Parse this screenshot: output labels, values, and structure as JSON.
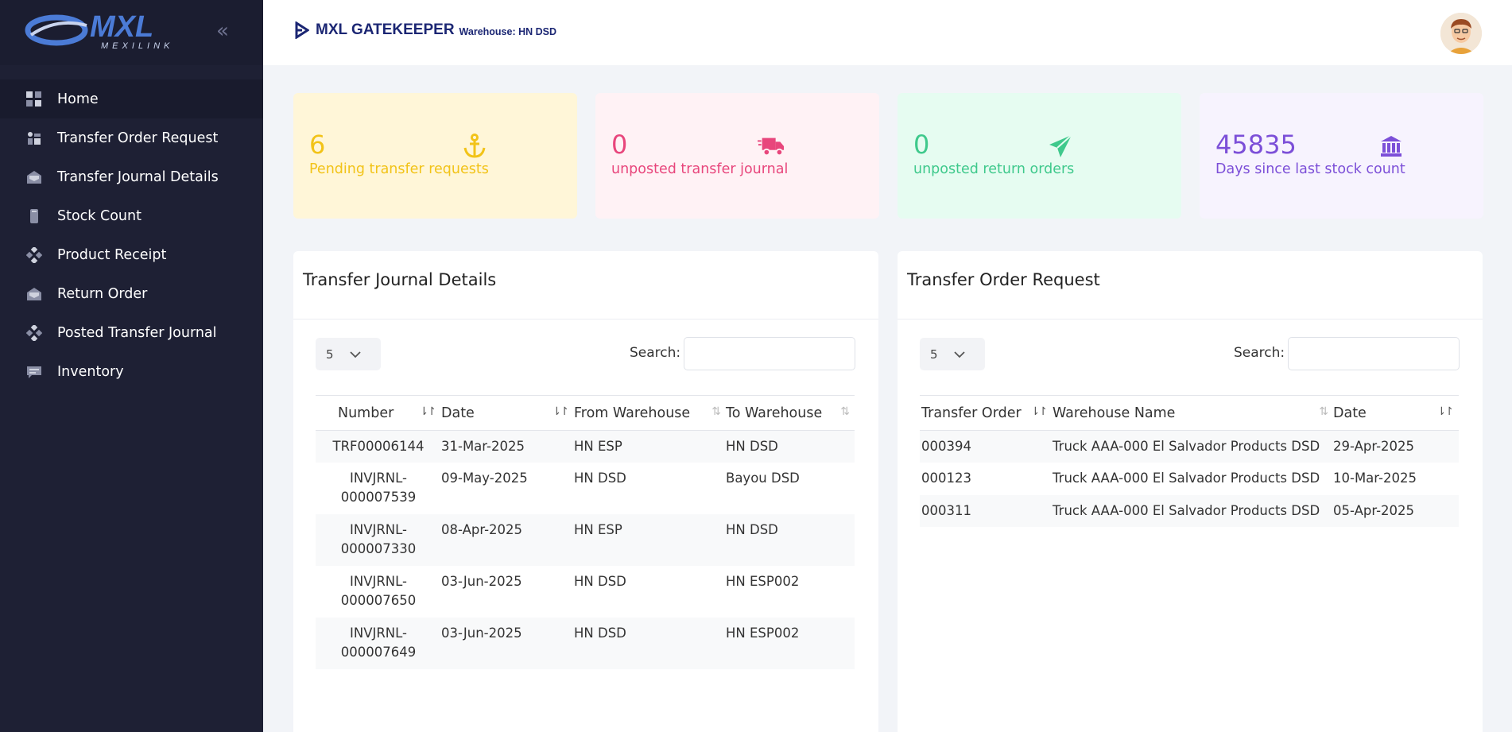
{
  "app": {
    "logo_text": "MXL",
    "logo_sub": "MEXILINK",
    "title": "MXL GATEKEEPER",
    "warehouse": "Warehouse: HN DSD"
  },
  "sidebar": {
    "items": [
      {
        "label": "Home",
        "icon": "home-icon"
      },
      {
        "label": "Transfer Order Request",
        "icon": "transfer-order-icon"
      },
      {
        "label": "Transfer Journal Details",
        "icon": "envelope-icon"
      },
      {
        "label": "Stock Count",
        "icon": "phone-icon"
      },
      {
        "label": "Product Receipt",
        "icon": "diamond-icon"
      },
      {
        "label": "Return Order",
        "icon": "envelope-icon"
      },
      {
        "label": "Posted Transfer Journal",
        "icon": "diamond-icon"
      },
      {
        "label": "Inventory",
        "icon": "message-icon"
      }
    ]
  },
  "cards": [
    {
      "value": "6",
      "label": "Pending transfer requests",
      "color": "#f2c318",
      "bg": "#fff6d8",
      "icon": "anchor-icon"
    },
    {
      "value": "0",
      "label": "unposted transfer journal",
      "color": "#e8467c",
      "bg": "#fff2f5",
      "icon": "truck-icon"
    },
    {
      "value": "0",
      "label": "unposted return orders",
      "color": "#3fc98c",
      "bg": "#e6fcf1",
      "icon": "paper-plane-icon"
    },
    {
      "value": "45835",
      "label": "Days since last stock count",
      "color": "#7c4fd8",
      "bg": "#f7f3fe",
      "icon": "bank-icon"
    }
  ],
  "journal_panel": {
    "title": "Transfer Journal Details",
    "page_length": "5",
    "search_label": "Search:",
    "search_value": "",
    "columns": [
      "Number",
      "Date",
      "From Warehouse",
      "To Warehouse"
    ],
    "rows": [
      [
        "TRF00006144",
        "31-Mar-2025",
        "HN ESP",
        "HN DSD"
      ],
      [
        "INVJRNL-\n000007539",
        "09-May-2025",
        "HN DSD",
        "Bayou DSD"
      ],
      [
        "INVJRNL-\n000007330",
        "08-Apr-2025",
        "HN ESP",
        "HN DSD"
      ],
      [
        "INVJRNL-\n000007650",
        "03-Jun-2025",
        "HN DSD",
        "HN ESP002"
      ],
      [
        "INVJRNL-\n000007649",
        "03-Jun-2025",
        "HN DSD",
        "HN ESP002"
      ]
    ]
  },
  "order_panel": {
    "title": "Transfer Order Request",
    "page_length": "5",
    "search_label": "Search:",
    "search_value": "",
    "columns": [
      "Transfer Order",
      "Warehouse Name",
      "Date"
    ],
    "rows": [
      [
        "000394",
        "Truck AAA-000 El Salvador Products DSD",
        "29-Apr-2025"
      ],
      [
        "000123",
        "Truck AAA-000 El Salvador Products DSD",
        "10-Mar-2025"
      ],
      [
        "000311",
        "Truck AAA-000 El Salvador Products DSD",
        "05-Apr-2025"
      ]
    ]
  }
}
